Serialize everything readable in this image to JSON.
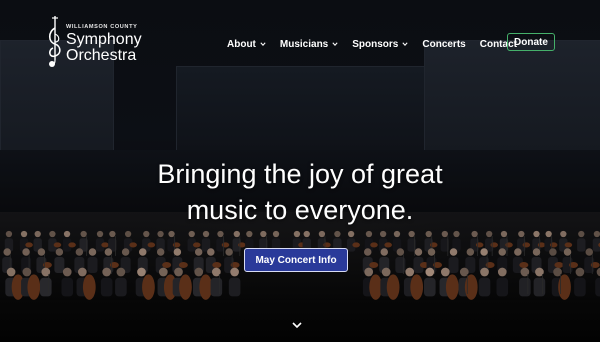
{
  "logo": {
    "county": "WILLIAMSON COUNTY",
    "line1": "Symphony",
    "line2": "Orchestra"
  },
  "nav": {
    "items": [
      {
        "label": "About",
        "has_dropdown": true
      },
      {
        "label": "Musicians",
        "has_dropdown": true
      },
      {
        "label": "Sponsors",
        "has_dropdown": true
      },
      {
        "label": "Concerts",
        "has_dropdown": false
      },
      {
        "label": "Contact",
        "has_dropdown": false
      }
    ],
    "donate_label": "Donate"
  },
  "hero": {
    "headline_line1": "Bringing the joy of great",
    "headline_line2": "music to everyone.",
    "cta_label": "May Concert Info"
  },
  "colors": {
    "donate_border": "#45b06a",
    "cta_background": "#2a3a9a",
    "text": "#ffffff"
  },
  "icons": {
    "logo": "treble-clef-violin-icon",
    "dropdown": "chevron-down-icon",
    "scroll": "chevron-down-icon"
  }
}
